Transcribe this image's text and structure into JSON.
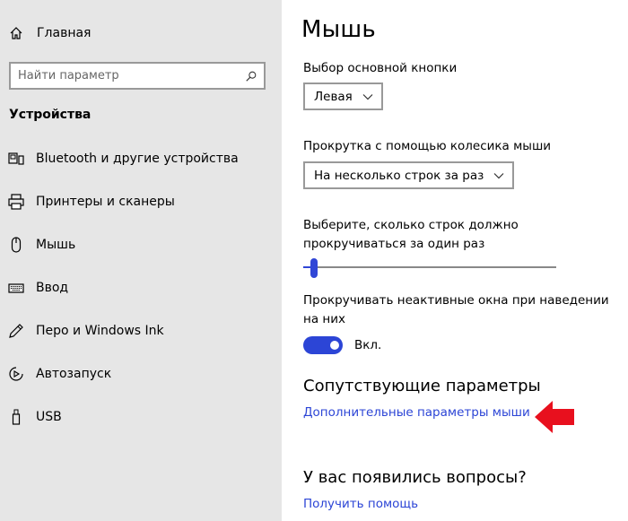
{
  "sidebar": {
    "home_label": "Главная",
    "search_placeholder": "Найти параметр",
    "section_title": "Устройства",
    "items": [
      {
        "label": "Bluetooth и другие устройства",
        "icon": "bluetooth-devices-icon"
      },
      {
        "label": "Принтеры и сканеры",
        "icon": "printer-icon"
      },
      {
        "label": "Мышь",
        "icon": "mouse-icon"
      },
      {
        "label": "Ввод",
        "icon": "keyboard-icon"
      },
      {
        "label": "Перо и Windows Ink",
        "icon": "pen-icon"
      },
      {
        "label": "Автозапуск",
        "icon": "autoplay-icon"
      },
      {
        "label": "USB",
        "icon": "usb-icon"
      }
    ]
  },
  "main": {
    "title": "Мышь",
    "primary_button": {
      "label": "Выбор основной кнопки",
      "value": "Левая"
    },
    "wheel_scroll": {
      "label": "Прокрутка с помощью колесика мыши",
      "value": "На несколько строк за раз"
    },
    "lines_slider": {
      "label": "Выберите, сколько строк должно прокручиваться за один раз",
      "value_fraction": 0.03
    },
    "inactive_scroll": {
      "label": "Прокручивать неактивные окна при наведении на них",
      "state_label": "Вкл.",
      "on": true
    },
    "related": {
      "title": "Сопутствующие параметры",
      "link": "Дополнительные параметры мыши"
    },
    "questions": {
      "title": "У вас появились вопросы?",
      "link": "Получить помощь"
    }
  },
  "colors": {
    "accent": "#2c45d6",
    "sidebar_bg": "#e6e6e6",
    "annotation_arrow": "#e8101e"
  }
}
